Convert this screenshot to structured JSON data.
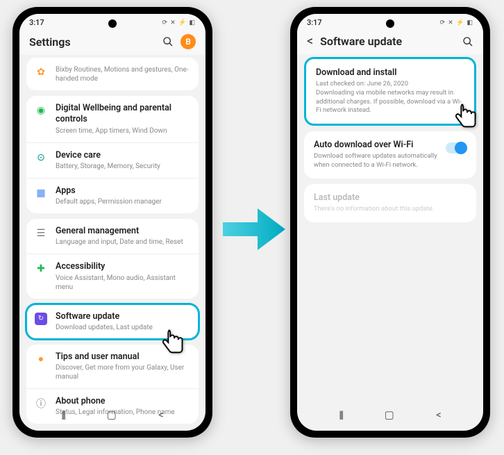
{
  "status": {
    "time": "3:17",
    "icons": "⟳ ✕ ⚡ ◧"
  },
  "left": {
    "header": {
      "title": "Settings",
      "avatar_initial": "B"
    },
    "group0": {
      "bixby": {
        "title": "",
        "sub": "Bixby Routines, Motions and gestures, One-handed mode"
      }
    },
    "group1": {
      "wellbeing": {
        "title": "Digital Wellbeing and parental controls",
        "sub": "Screen time, App timers, Wind Down"
      },
      "devicecare": {
        "title": "Device care",
        "sub": "Battery, Storage, Memory, Security"
      },
      "apps": {
        "title": "Apps",
        "sub": "Default apps, Permission manager"
      }
    },
    "group2": {
      "general": {
        "title": "General management",
        "sub": "Language and input, Date and time, Reset"
      },
      "accessibility": {
        "title": "Accessibility",
        "sub": "Voice Assistant, Mono audio, Assistant menu"
      }
    },
    "group3": {
      "software": {
        "title": "Software update",
        "sub": "Download updates, Last update"
      }
    },
    "group4": {
      "tips": {
        "title": "Tips and user manual",
        "sub": "Discover, Get more from your Galaxy, User manual"
      },
      "about": {
        "title": "About phone",
        "sub": "Status, Legal information, Phone name"
      }
    }
  },
  "right": {
    "header": {
      "title": "Software update"
    },
    "download": {
      "title": "Download and install",
      "sub": "Last checked on: June 26, 2020\nDownloading via mobile networks may result in additional charges. If possible, download via a Wi-Fi network instead."
    },
    "auto": {
      "title": "Auto download over Wi-Fi",
      "sub": "Download software updates automatically when connected to a Wi-Fi network."
    },
    "last": {
      "title": "Last update",
      "sub": "There's no information about this update."
    }
  },
  "nav": {
    "recent": "|||",
    "home": "◯",
    "back": "⟨"
  }
}
